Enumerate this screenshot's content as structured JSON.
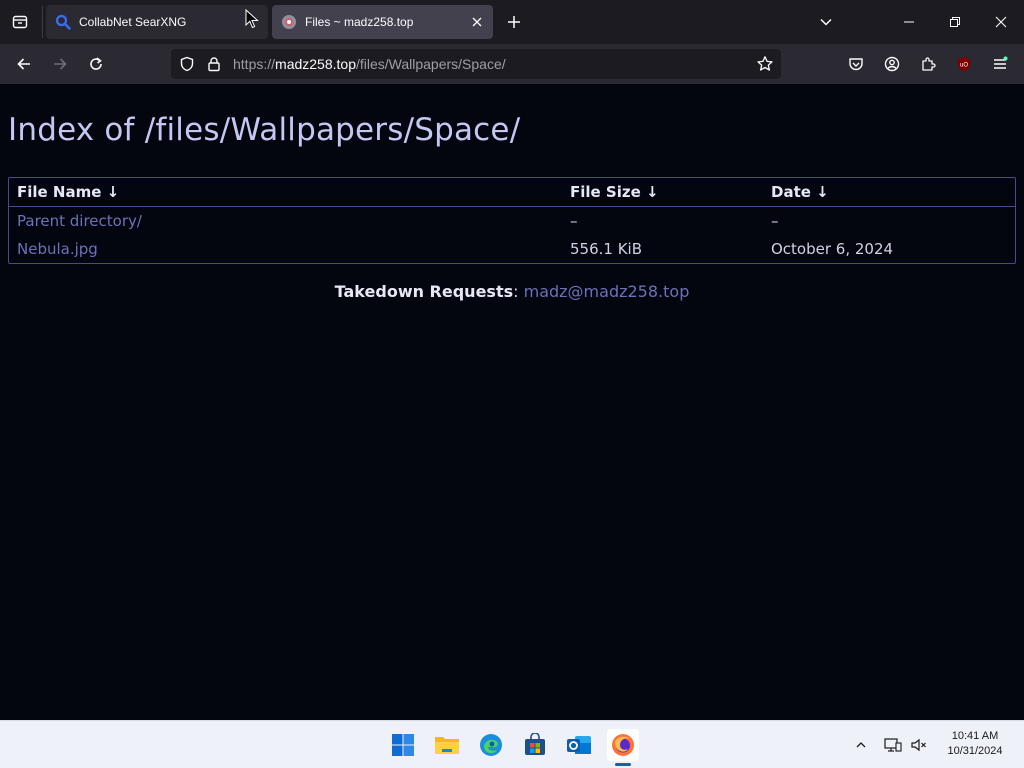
{
  "browser": {
    "tabs": [
      {
        "title": "CollabNet SearXNG",
        "active": false
      },
      {
        "title": "Files ~ madz258.top",
        "active": true
      }
    ],
    "url": {
      "scheme": "https://",
      "host": "madz258.top",
      "path": "/files/Wallpapers/Space/"
    }
  },
  "page": {
    "title": "Index of /files/Wallpapers/Space/",
    "columns": [
      {
        "label": "File Name",
        "sort_icon": "↓"
      },
      {
        "label": "File Size",
        "sort_icon": "↓"
      },
      {
        "label": "Date",
        "sort_icon": "↓"
      }
    ],
    "rows": [
      {
        "name": "Parent directory/",
        "size": "–",
        "date": "–"
      },
      {
        "name": "Nebula.jpg",
        "size": "556.1 KiB",
        "date": "October 6, 2024"
      }
    ],
    "footer": {
      "label": "Takedown Requests",
      "separator": ":",
      "email": "madz@madz258.top"
    }
  },
  "taskbar": {
    "time": "10:41 AM",
    "date": "10/31/2024"
  },
  "colors": {
    "page_bg": "#03050f",
    "heading": "#c4c7f1",
    "link": "#6b72b8",
    "table_border": "#484c8c"
  }
}
